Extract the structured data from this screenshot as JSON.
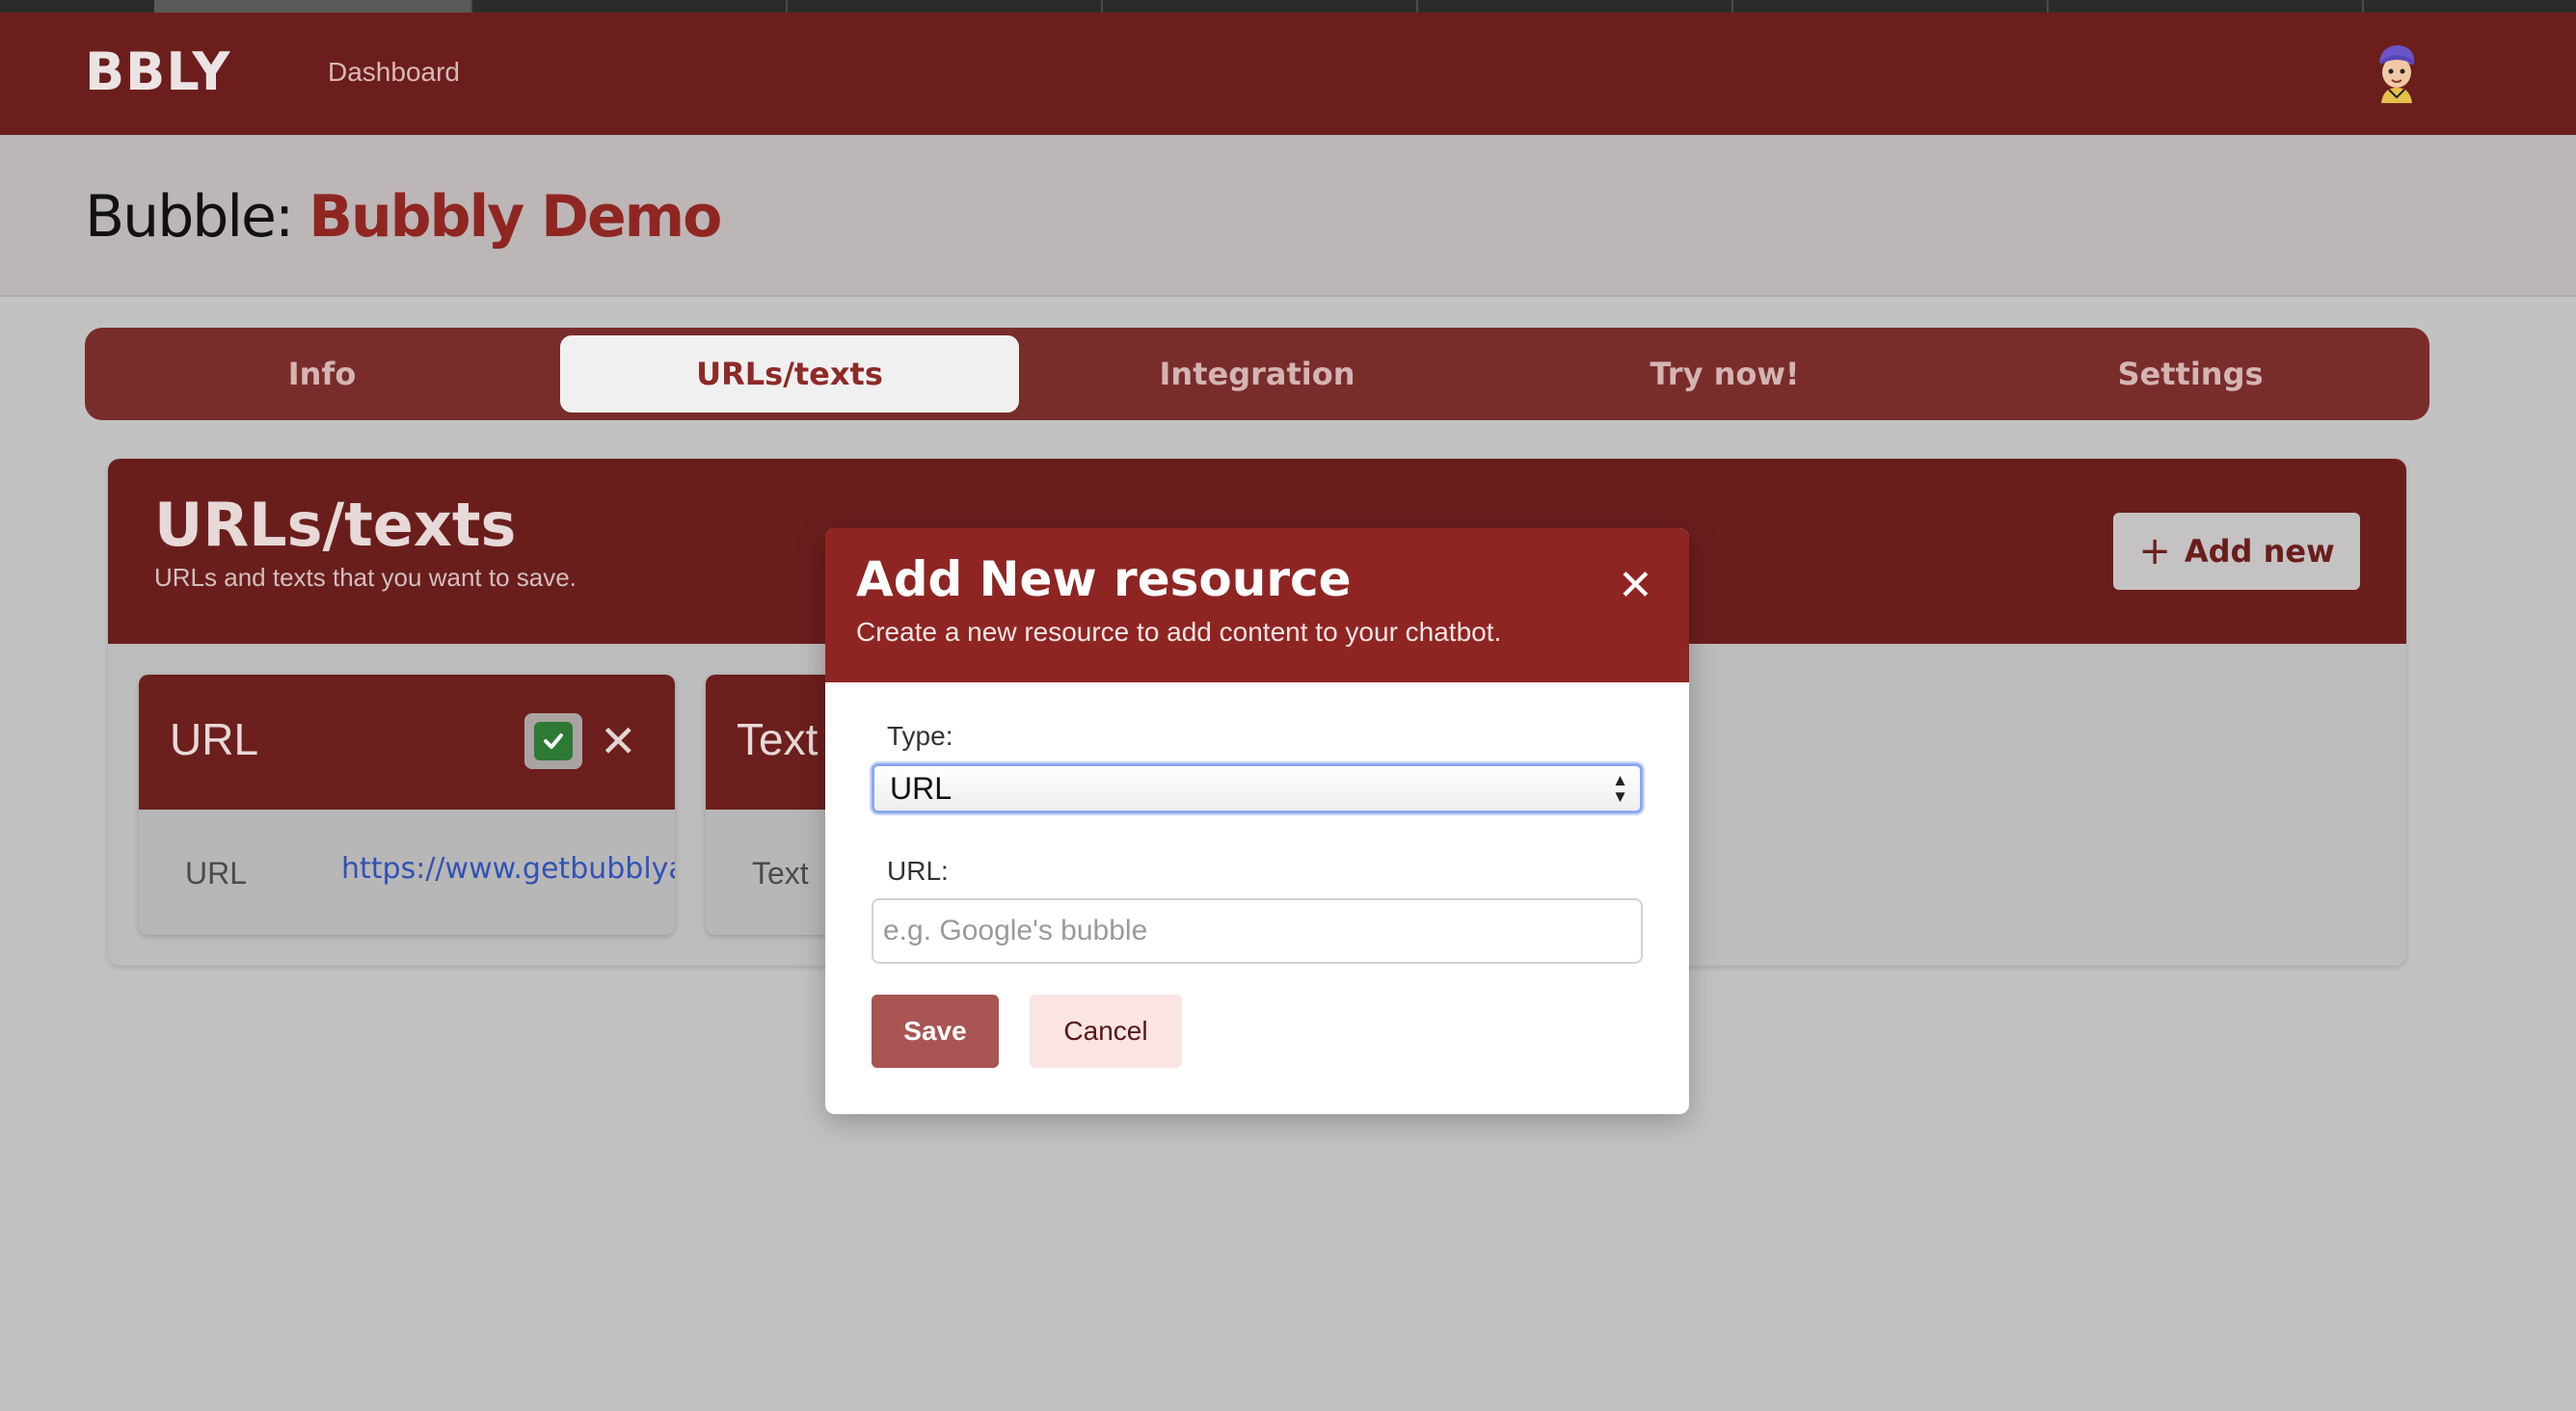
{
  "header": {
    "brand": "BBLY",
    "nav_dashboard": "Dashboard"
  },
  "page": {
    "title_prefix": "Bubble: ",
    "bubble_name": "Bubbly Demo"
  },
  "tabs": [
    {
      "label": "Info",
      "active": false
    },
    {
      "label": "URLs/texts",
      "active": true
    },
    {
      "label": "Integration",
      "active": false
    },
    {
      "label": "Try now!",
      "active": false
    },
    {
      "label": "Settings",
      "active": false
    }
  ],
  "section": {
    "title": "URLs/texts",
    "subtitle": "URLs and texts that you want to save.",
    "add_new_plus": "+",
    "add_new_label": "Add new"
  },
  "resources": [
    {
      "title": "URL",
      "row_label": "URL",
      "row_value": "https://www.getbubblyai",
      "checked": true
    },
    {
      "title": "Text",
      "row_label": "Text"
    }
  ],
  "modal": {
    "title": "Add New resource",
    "subtitle": "Create a new resource to add content to your chatbot.",
    "close": "✕",
    "type_label": "Type:",
    "type_value": "URL",
    "url_label": "URL:",
    "url_placeholder": "e.g. Google's bubble",
    "save_label": "Save",
    "cancel_label": "Cancel"
  },
  "colors": {
    "primary": "#6c1e1c",
    "modal_header": "#8e2523",
    "accent_text": "#8f2622",
    "link": "#3152b5",
    "check": "#2d7a35"
  }
}
